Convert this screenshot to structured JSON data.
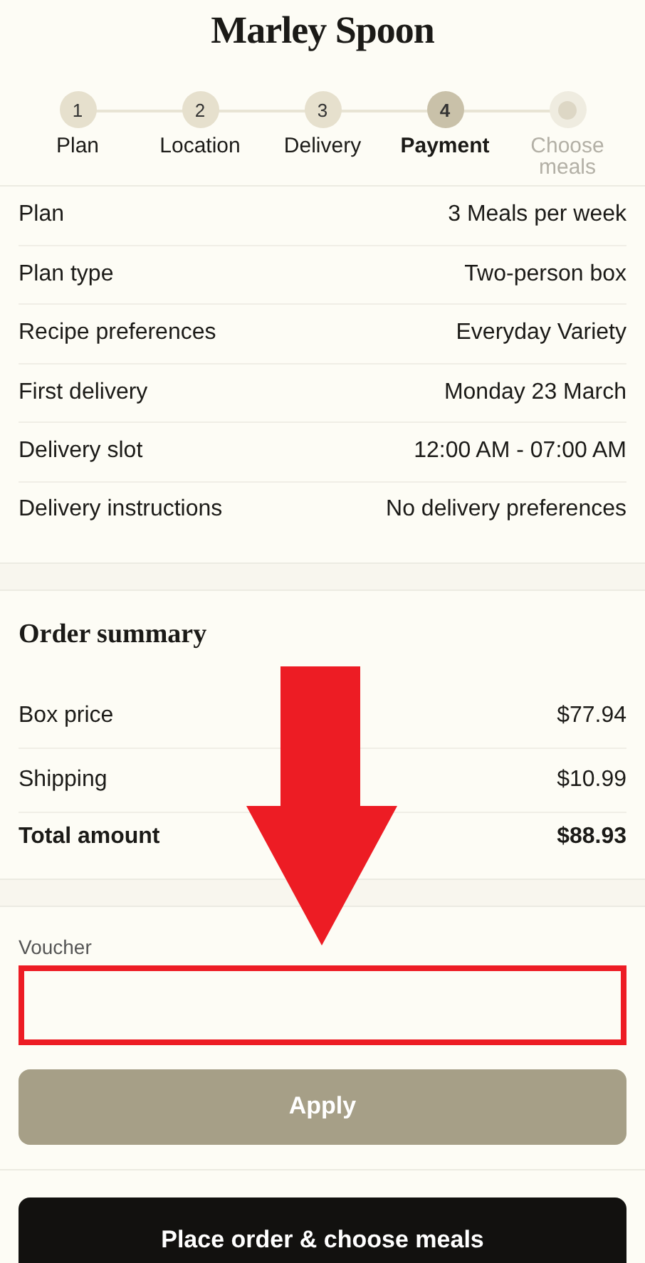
{
  "header": {
    "logo": "Marley Spoon"
  },
  "steps": [
    {
      "number": "1",
      "label": "Plan",
      "selected": false,
      "reachable": true
    },
    {
      "number": "2",
      "label": "Location",
      "selected": false,
      "reachable": true
    },
    {
      "number": "3",
      "label": "Delivery",
      "selected": false,
      "reachable": true
    },
    {
      "number": "4",
      "label": "Payment",
      "selected": true,
      "reachable": true
    },
    {
      "label": "Choose meals",
      "selected": false,
      "reachable": false
    }
  ],
  "details": [
    {
      "label": "Plan",
      "value": "3 Meals per week"
    },
    {
      "label": "Plan type",
      "value": "Two-person box"
    },
    {
      "label": "Recipe preferences",
      "value": "Everyday Variety"
    },
    {
      "label": "First delivery",
      "value": "Monday 23 March"
    },
    {
      "label": "Delivery slot",
      "value": "12:00 AM - 07:00 AM"
    },
    {
      "label": "Delivery instructions",
      "value": "No delivery preferences"
    }
  ],
  "order_summary": {
    "title": "Order summary",
    "rows": [
      {
        "label": "Box price",
        "value": "$77.94",
        "total": false
      },
      {
        "label": "Shipping",
        "value": "$10.99",
        "total": false
      },
      {
        "label": "Total amount",
        "value": "$88.93",
        "total": true
      }
    ]
  },
  "voucher": {
    "label": "Voucher",
    "apply_button": {
      "label": "Apply",
      "disabled": true
    }
  },
  "place_order_button": "Place order & choose meals",
  "annotations": {
    "arrow": true,
    "voucher_frame": true
  }
}
